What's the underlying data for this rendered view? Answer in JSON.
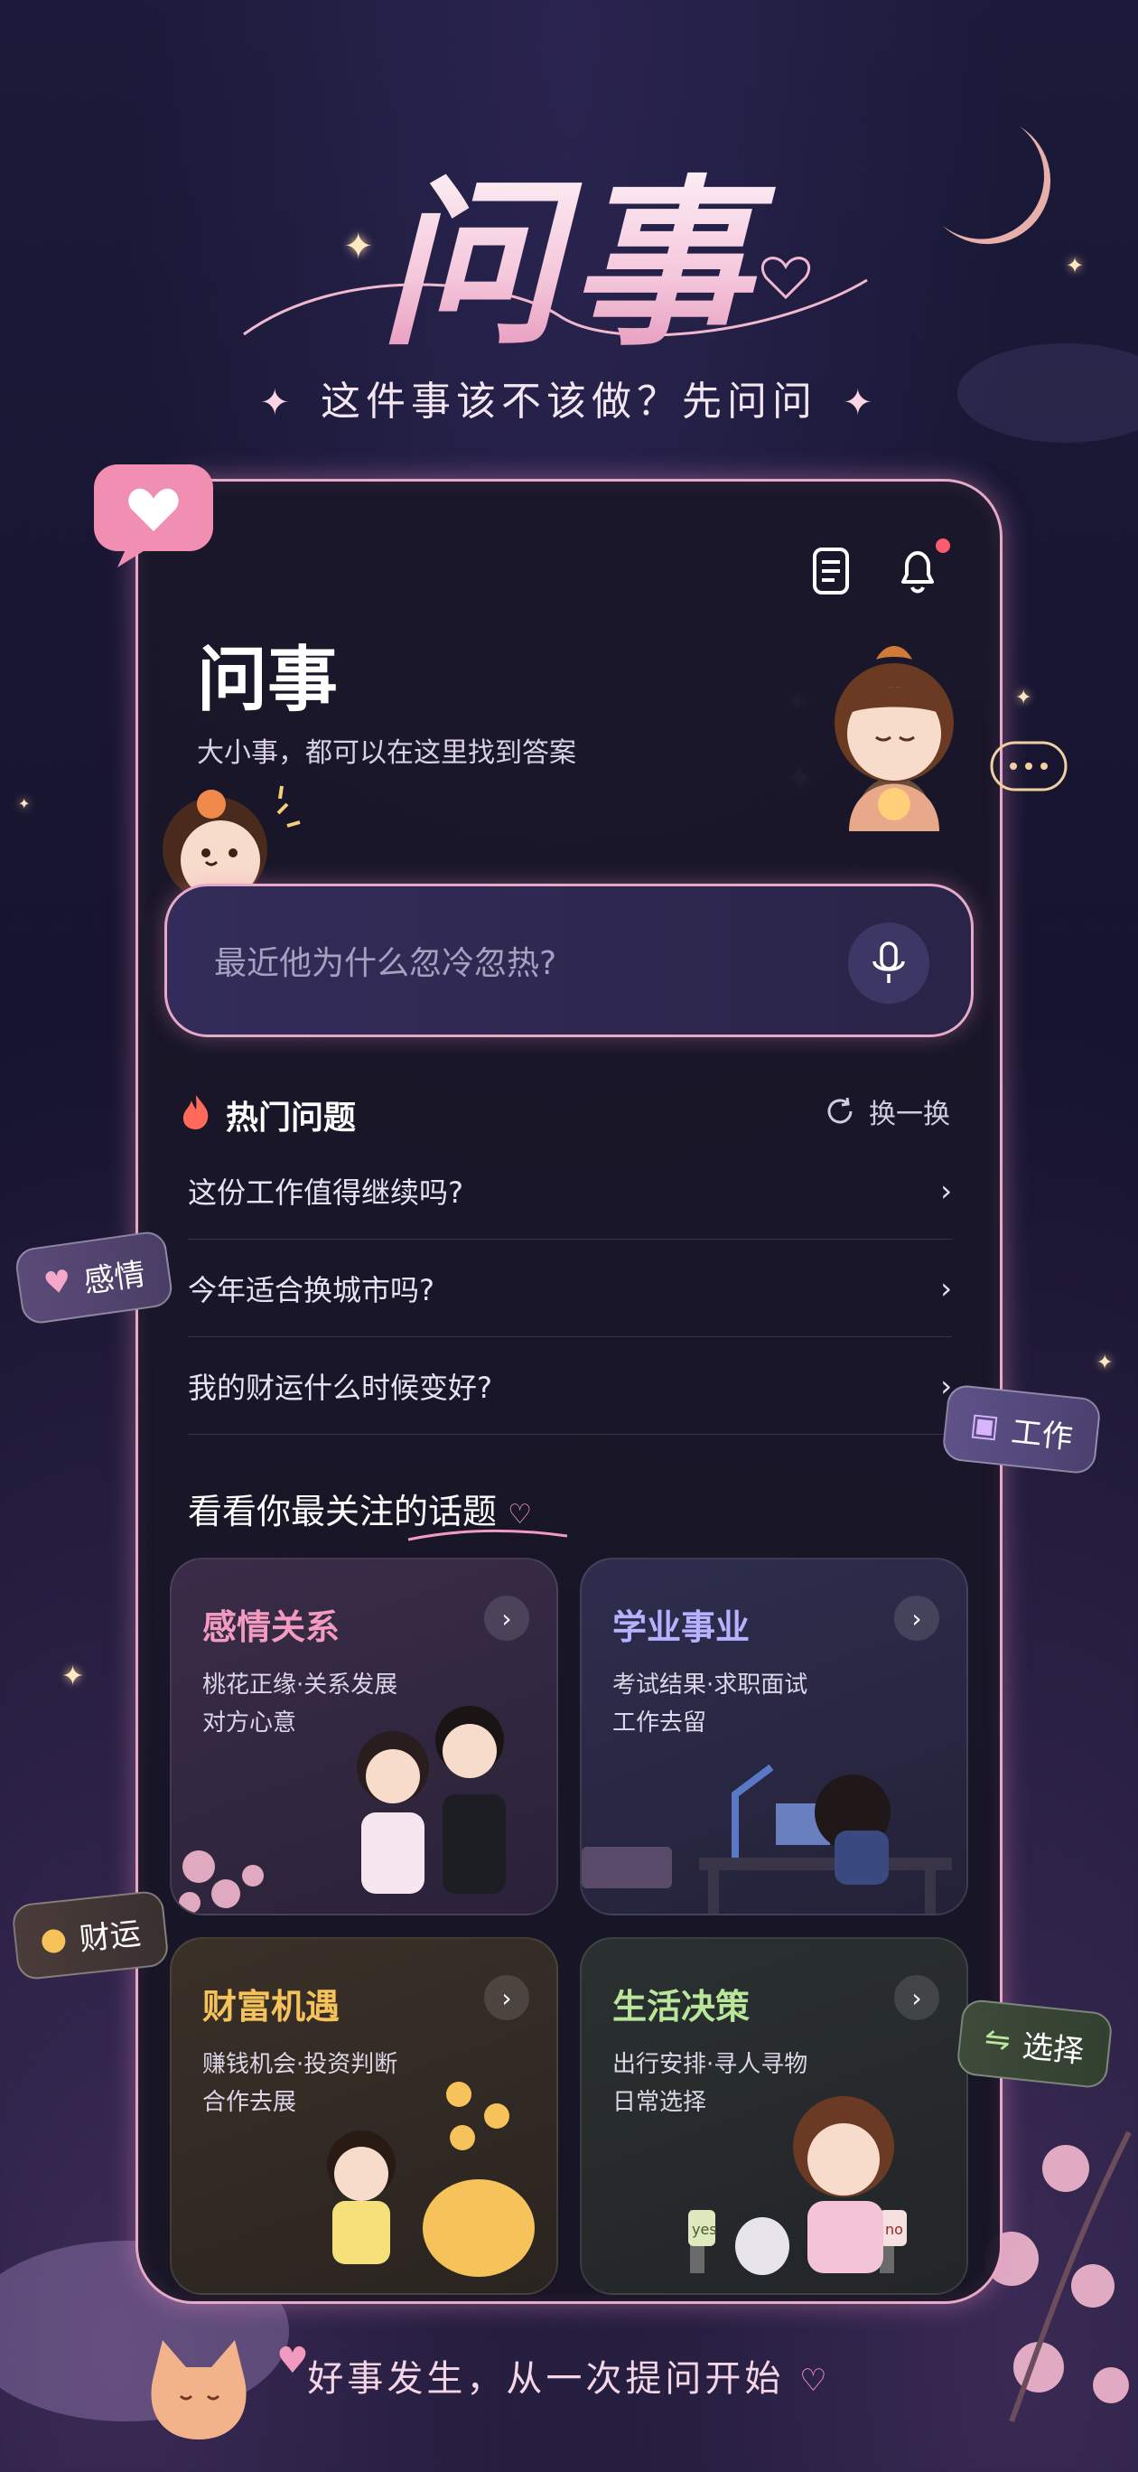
{
  "hero": {
    "title": "问事",
    "subtitle": "这件事该不该做？先问问"
  },
  "header": {
    "app_title": "问事",
    "app_subtitle": "大小事，都可以在这里找到答案",
    "notification_badge_color": "#ff5b6e"
  },
  "search": {
    "placeholder": "最近他为什么忽冷忽热?"
  },
  "hot_questions": {
    "title": "热门问题",
    "shuffle_label": "换一换",
    "items": [
      "这份工作值得继续吗?",
      "今年适合换城市吗?",
      "我的财运什么时候变好?"
    ]
  },
  "topics": {
    "title": "看看你最关注的话题",
    "cards": [
      {
        "title": "感情关系",
        "desc": "桃花正缘·关系发展\n对方心意",
        "color": "#f29ac0"
      },
      {
        "title": "学业事业",
        "desc": "考试结果·求职面试\n工作去留",
        "color": "#b7b2ff"
      },
      {
        "title": "财富机遇",
        "desc": "赚钱机会·投资判断\n合作去展",
        "color": "#f6c35b"
      },
      {
        "title": "生活决策",
        "desc": "出行安排·寻人寻物\n日常选择",
        "color": "#b9e69a"
      }
    ],
    "illustration_labels": {
      "yes": "yes",
      "no": "no"
    }
  },
  "floating_tags": {
    "love": "感情",
    "work": "工作",
    "wealth": "财运",
    "choice": "选择"
  },
  "footer": {
    "tagline": "好事发生，从一次提问开始"
  },
  "colors": {
    "accent_pink": "#e6a9c8",
    "background": "#1c1a3a"
  }
}
